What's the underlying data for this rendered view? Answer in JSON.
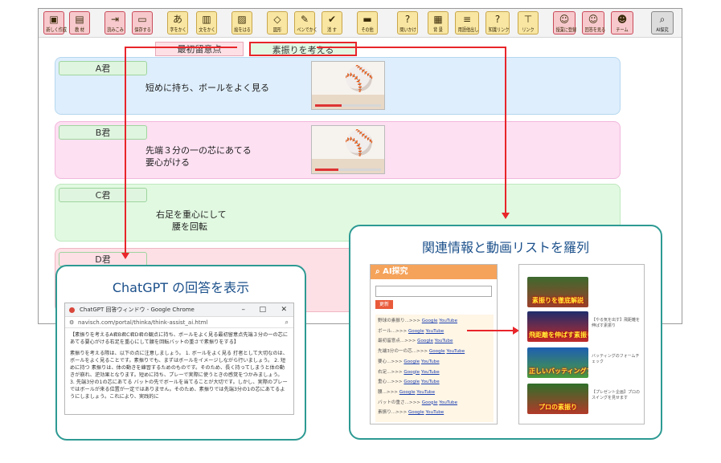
{
  "toolbar": {
    "buttons": [
      {
        "label": "新しく作成",
        "icon": "new-file-icon",
        "glyph": "▣"
      },
      {
        "label": "教 材",
        "icon": "material-icon",
        "glyph": "▤"
      },
      {
        "label": "読みこみ",
        "icon": "import-icon",
        "glyph": "⇥"
      },
      {
        "label": "保存する",
        "icon": "save-icon",
        "glyph": "▭"
      },
      {
        "label": "字をかく",
        "icon": "write-text-icon",
        "glyph": "あ"
      },
      {
        "label": "文をかく",
        "icon": "write-sentence-icon",
        "glyph": "▥"
      },
      {
        "label": "絵をはる",
        "icon": "paste-image-icon",
        "glyph": "▨"
      },
      {
        "label": "図形",
        "icon": "shape-icon",
        "glyph": "◇"
      },
      {
        "label": "ペンでかく",
        "icon": "pen-icon",
        "glyph": "✎"
      },
      {
        "label": "消 す",
        "icon": "erase-icon",
        "glyph": "✔"
      },
      {
        "label": "その他",
        "icon": "other-icon",
        "glyph": "▬"
      },
      {
        "label": "問いかけ",
        "icon": "question-icon",
        "glyph": "?"
      },
      {
        "label": "背 景",
        "icon": "background-icon",
        "glyph": "▦"
      },
      {
        "label": "用語他出し",
        "icon": "terms-icon",
        "glyph": "≡"
      },
      {
        "label": "知識リンク",
        "icon": "knowledge-link-icon",
        "glyph": "?"
      },
      {
        "label": "リンク",
        "icon": "link-icon",
        "glyph": "⊤"
      },
      {
        "label": "授業に登録",
        "icon": "register-class-icon",
        "glyph": "☺"
      },
      {
        "label": "回答を見る",
        "icon": "view-answers-icon",
        "glyph": "☺"
      },
      {
        "label": "チーム",
        "icon": "team-icon",
        "glyph": "☻"
      },
      {
        "label": "AI探究",
        "icon": "ai-search-icon",
        "glyph": "⌕"
      }
    ]
  },
  "tabs": [
    {
      "label": "最初留意点"
    },
    {
      "label": "素振りを考える"
    }
  ],
  "rows": [
    {
      "name": "A君",
      "text": [
        "短めに持ち、ボールをよく見る"
      ],
      "progress": 0.4
    },
    {
      "name": "B君",
      "text": [
        "先端３分の一の芯にあてる",
        "要心がける"
      ],
      "progress": 0.35
    },
    {
      "name": "C君",
      "text": [
        "右足を重心にして",
        "腰を回転"
      ]
    },
    {
      "name": "D君",
      "text": []
    }
  ],
  "chatgpt_callout": {
    "title": "ChatGPT の回答を表示",
    "window_title": "ChatGPT 回答ウィンドウ - Google Chrome",
    "url": "navisch.com/portal/thinka/think-assist_ai.html",
    "paragraphs": [
      "【素振りを考えるA君B君C君D君の観点に持ち、ボールをよく見る最初留意点先端３分の一の芯にあてる要心がける右足を重心にして腰を回転バットの重さで素振りをする】",
      "素振りを考える際は、以下の点に注意しましょう。 1. ボールをよく見る 打者として大切なのは、ボールをよく見ることです。素振りでも、まずはボールをイメージしながら行いましょう。 2. 短めに持つ 素振りは、体の動きを練習するためのものです。そのため、長く持ってしまうと体の動きが崩れ、逆効果となります。短めに持ち、プレーで実際に使うときの感覚をつかみましょう。 3. 先端3分の1の芯にあてる バットの先でボールを当てることが大切です。しかし、実際のプレーではボールが来る位置が一定ではありません。そのため、素振りでは先端3分の1の芯にあてるようにしましょう。これにより、実践的に"
    ]
  },
  "related_callout": {
    "title": "関連情報と動画リストを羅列",
    "header": "AI探究",
    "update_button": "更新",
    "items": [
      "野球の素振り...>>> ",
      "ボール...>>> ",
      "最初留意点...>>> ",
      "先端3分の一の芯...>>> ",
      "要心...>>> ",
      "右足...>>> ",
      "重心...>>> ",
      "腰...>>> ",
      "バットの重さ...>>> ",
      "素振り...>>> "
    ],
    "link_google": "Google",
    "link_youtube": "YouTube",
    "videos": [
      {
        "caption": "素振りを徹底解説",
        "meta": ""
      },
      {
        "caption": "飛距離を伸ばす素振り練習法",
        "meta": "【やる気を出す】飛距離を伸ばす素振り"
      },
      {
        "caption": "正しいバッティングフォーム",
        "meta": "バッティングのフォームチェック"
      },
      {
        "caption": "プロの素振り",
        "meta": "【プレゼント企画】プロのスイングを見せます"
      }
    ]
  },
  "colors": {
    "row_a": "#deeefc",
    "row_b": "#fde0f2",
    "row_c": "#e1f9e1",
    "row_d": "#fde0e6",
    "callout_border": "#2d9a93",
    "arrow_red": "#e8252a"
  }
}
